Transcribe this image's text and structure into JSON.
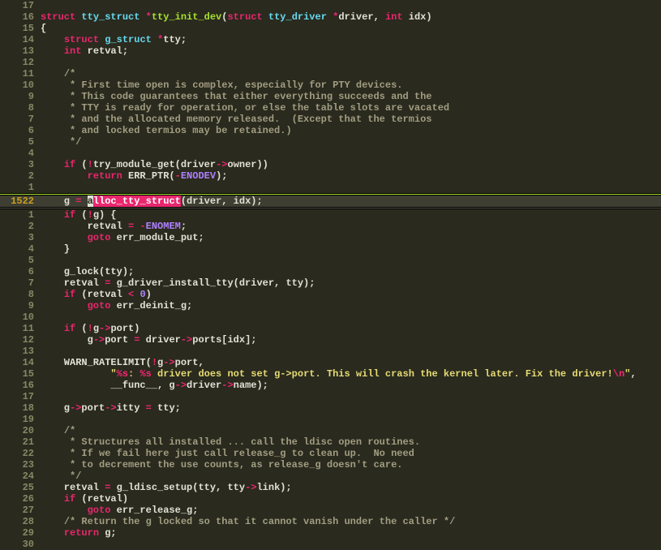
{
  "editor": {
    "cursor_line_abs": 1522,
    "lines": [
      {
        "n": "17",
        "cls": "",
        "spans": [
          [
            "id",
            ""
          ]
        ]
      },
      {
        "n": "16",
        "cls": "",
        "spans": [
          [
            "kw",
            "struct"
          ],
          [
            "id",
            " "
          ],
          [
            "type",
            "tty_struct"
          ],
          [
            "id",
            " "
          ],
          [
            "op",
            "*"
          ],
          [
            "fn",
            "tty_init_dev"
          ],
          [
            "pun",
            "("
          ],
          [
            "kw",
            "struct"
          ],
          [
            "id",
            " "
          ],
          [
            "type",
            "tty_driver"
          ],
          [
            "id",
            " "
          ],
          [
            "op",
            "*"
          ],
          [
            "id",
            "driver"
          ],
          [
            "pun",
            ", "
          ],
          [
            "kw",
            "int"
          ],
          [
            "id",
            " idx"
          ],
          [
            "pun",
            ")"
          ]
        ]
      },
      {
        "n": "15",
        "cls": "",
        "spans": [
          [
            "pun",
            "{"
          ]
        ]
      },
      {
        "n": "14",
        "cls": "",
        "spans": [
          [
            "id",
            "    "
          ],
          [
            "kw",
            "struct"
          ],
          [
            "id",
            " "
          ],
          [
            "type",
            "g_struct"
          ],
          [
            "id",
            " "
          ],
          [
            "op",
            "*"
          ],
          [
            "id",
            "tty;"
          ]
        ]
      },
      {
        "n": "13",
        "cls": "",
        "spans": [
          [
            "id",
            "    "
          ],
          [
            "kw",
            "int"
          ],
          [
            "id",
            " retval;"
          ]
        ]
      },
      {
        "n": "12",
        "cls": "",
        "spans": [
          [
            "id",
            ""
          ]
        ]
      },
      {
        "n": "11",
        "cls": "",
        "spans": [
          [
            "id",
            "    "
          ],
          [
            "cmt",
            "/*"
          ]
        ]
      },
      {
        "n": "10",
        "cls": "",
        "spans": [
          [
            "id",
            "    "
          ],
          [
            "cmt",
            " * First time open is complex, especially for PTY devices."
          ]
        ]
      },
      {
        "n": "9",
        "cls": "",
        "spans": [
          [
            "id",
            "    "
          ],
          [
            "cmt",
            " * This code guarantees that either everything succeeds and the"
          ]
        ]
      },
      {
        "n": "8",
        "cls": "",
        "spans": [
          [
            "id",
            "    "
          ],
          [
            "cmt",
            " * TTY is ready for operation, or else the table slots are vacated"
          ]
        ]
      },
      {
        "n": "7",
        "cls": "",
        "spans": [
          [
            "id",
            "    "
          ],
          [
            "cmt",
            " * and the allocated memory released.  (Except that the termios"
          ]
        ]
      },
      {
        "n": "6",
        "cls": "",
        "spans": [
          [
            "id",
            "    "
          ],
          [
            "cmt",
            " * and locked termios may be retained.)"
          ]
        ]
      },
      {
        "n": "5",
        "cls": "",
        "spans": [
          [
            "id",
            "    "
          ],
          [
            "cmt",
            " */"
          ]
        ]
      },
      {
        "n": "4",
        "cls": "",
        "spans": [
          [
            "id",
            ""
          ]
        ]
      },
      {
        "n": "3",
        "cls": "",
        "spans": [
          [
            "id",
            "    "
          ],
          [
            "kw",
            "if"
          ],
          [
            "id",
            " ("
          ],
          [
            "op",
            "!"
          ],
          [
            "id",
            "try_module_get(driver"
          ],
          [
            "op",
            "->"
          ],
          [
            "id",
            "owner))"
          ]
        ]
      },
      {
        "n": "2",
        "cls": "",
        "spans": [
          [
            "id",
            "        "
          ],
          [
            "kw",
            "return"
          ],
          [
            "id",
            " ERR_PTR("
          ],
          [
            "op",
            "-"
          ],
          [
            "const",
            "ENODEV"
          ],
          [
            "id",
            ");"
          ]
        ]
      },
      {
        "n": "1",
        "cls": "",
        "spans": [
          [
            "id",
            ""
          ]
        ]
      },
      {
        "n": "1522",
        "cls": "current",
        "abs": true,
        "spans": [
          [
            "id",
            "    g "
          ],
          [
            "op",
            "="
          ],
          [
            "id",
            " "
          ],
          [
            "cursor",
            "a"
          ],
          [
            "hl",
            "lloc_tty_struct"
          ],
          [
            "id",
            "(driver, idx);"
          ]
        ]
      },
      {
        "n": "1",
        "cls": "",
        "spans": [
          [
            "id",
            "    "
          ],
          [
            "kw",
            "if"
          ],
          [
            "id",
            " ("
          ],
          [
            "op",
            "!"
          ],
          [
            "id",
            "g) {"
          ]
        ]
      },
      {
        "n": "2",
        "cls": "",
        "spans": [
          [
            "id",
            "        retval "
          ],
          [
            "op",
            "="
          ],
          [
            "id",
            " "
          ],
          [
            "op",
            "-"
          ],
          [
            "const",
            "ENOMEM"
          ],
          [
            "id",
            ";"
          ]
        ]
      },
      {
        "n": "3",
        "cls": "",
        "spans": [
          [
            "id",
            "        "
          ],
          [
            "kw",
            "goto"
          ],
          [
            "id",
            " err_module_put;"
          ]
        ]
      },
      {
        "n": "4",
        "cls": "",
        "spans": [
          [
            "id",
            "    }"
          ]
        ]
      },
      {
        "n": "5",
        "cls": "",
        "spans": [
          [
            "id",
            ""
          ]
        ]
      },
      {
        "n": "6",
        "cls": "",
        "spans": [
          [
            "id",
            "    g_lock(tty);"
          ]
        ]
      },
      {
        "n": "7",
        "cls": "",
        "spans": [
          [
            "id",
            "    retval "
          ],
          [
            "op",
            "="
          ],
          [
            "id",
            " g_driver_install_tty(driver, tty);"
          ]
        ]
      },
      {
        "n": "8",
        "cls": "",
        "spans": [
          [
            "id",
            "    "
          ],
          [
            "kw",
            "if"
          ],
          [
            "id",
            " (retval "
          ],
          [
            "op",
            "<"
          ],
          [
            "id",
            " "
          ],
          [
            "num",
            "0"
          ],
          [
            "id",
            ")"
          ]
        ]
      },
      {
        "n": "9",
        "cls": "",
        "spans": [
          [
            "id",
            "        "
          ],
          [
            "kw",
            "goto"
          ],
          [
            "id",
            " err_deinit_g;"
          ]
        ]
      },
      {
        "n": "10",
        "cls": "",
        "spans": [
          [
            "id",
            ""
          ]
        ]
      },
      {
        "n": "11",
        "cls": "",
        "spans": [
          [
            "id",
            "    "
          ],
          [
            "kw",
            "if"
          ],
          [
            "id",
            " ("
          ],
          [
            "op",
            "!"
          ],
          [
            "id",
            "g"
          ],
          [
            "op",
            "->"
          ],
          [
            "id",
            "port)"
          ]
        ]
      },
      {
        "n": "12",
        "cls": "",
        "spans": [
          [
            "id",
            "        g"
          ],
          [
            "op",
            "->"
          ],
          [
            "id",
            "port "
          ],
          [
            "op",
            "="
          ],
          [
            "id",
            " driver"
          ],
          [
            "op",
            "->"
          ],
          [
            "id",
            "ports[idx];"
          ]
        ]
      },
      {
        "n": "13",
        "cls": "",
        "spans": [
          [
            "id",
            ""
          ]
        ]
      },
      {
        "n": "14",
        "cls": "",
        "spans": [
          [
            "id",
            "    WARN_RATELIMIT("
          ],
          [
            "op",
            "!"
          ],
          [
            "id",
            "g"
          ],
          [
            "op",
            "->"
          ],
          [
            "id",
            "port,"
          ]
        ]
      },
      {
        "n": "15",
        "cls": "",
        "spans": [
          [
            "id",
            "            "
          ],
          [
            "str",
            "\""
          ],
          [
            "esc",
            "%s"
          ],
          [
            "str",
            ": "
          ],
          [
            "esc",
            "%s"
          ],
          [
            "str",
            " driver does not set g->port. This will crash the kernel later. Fix the driver!"
          ],
          [
            "esc",
            "\\n"
          ],
          [
            "str",
            "\""
          ],
          [
            "id",
            ","
          ]
        ]
      },
      {
        "n": "16",
        "cls": "",
        "spans": [
          [
            "id",
            "            __func__, g"
          ],
          [
            "op",
            "->"
          ],
          [
            "id",
            "driver"
          ],
          [
            "op",
            "->"
          ],
          [
            "id",
            "name);"
          ]
        ]
      },
      {
        "n": "17",
        "cls": "",
        "spans": [
          [
            "id",
            ""
          ]
        ]
      },
      {
        "n": "18",
        "cls": "",
        "spans": [
          [
            "id",
            "    g"
          ],
          [
            "op",
            "->"
          ],
          [
            "id",
            "port"
          ],
          [
            "op",
            "->"
          ],
          [
            "id",
            "itty "
          ],
          [
            "op",
            "="
          ],
          [
            "id",
            " tty;"
          ]
        ]
      },
      {
        "n": "19",
        "cls": "",
        "spans": [
          [
            "id",
            ""
          ]
        ]
      },
      {
        "n": "20",
        "cls": "",
        "spans": [
          [
            "id",
            "    "
          ],
          [
            "cmt",
            "/*"
          ]
        ]
      },
      {
        "n": "21",
        "cls": "",
        "spans": [
          [
            "id",
            "    "
          ],
          [
            "cmt",
            " * Structures all installed ... call the ldisc open routines."
          ]
        ]
      },
      {
        "n": "22",
        "cls": "",
        "spans": [
          [
            "id",
            "    "
          ],
          [
            "cmt",
            " * If we fail here just call release_g to clean up.  No need"
          ]
        ]
      },
      {
        "n": "23",
        "cls": "",
        "spans": [
          [
            "id",
            "    "
          ],
          [
            "cmt",
            " * to decrement the use counts, as release_g doesn't care."
          ]
        ]
      },
      {
        "n": "24",
        "cls": "",
        "spans": [
          [
            "id",
            "    "
          ],
          [
            "cmt",
            " */"
          ]
        ]
      },
      {
        "n": "25",
        "cls": "",
        "spans": [
          [
            "id",
            "    retval "
          ],
          [
            "op",
            "="
          ],
          [
            "id",
            " g_ldisc_setup(tty, tty"
          ],
          [
            "op",
            "->"
          ],
          [
            "id",
            "link);"
          ]
        ]
      },
      {
        "n": "26",
        "cls": "",
        "spans": [
          [
            "id",
            "    "
          ],
          [
            "kw",
            "if"
          ],
          [
            "id",
            " (retval)"
          ]
        ]
      },
      {
        "n": "27",
        "cls": "",
        "spans": [
          [
            "id",
            "        "
          ],
          [
            "kw",
            "goto"
          ],
          [
            "id",
            " err_release_g;"
          ]
        ]
      },
      {
        "n": "28",
        "cls": "",
        "spans": [
          [
            "id",
            "    "
          ],
          [
            "cmt",
            "/* Return the g locked so that it cannot vanish under the caller */"
          ]
        ]
      },
      {
        "n": "29",
        "cls": "",
        "spans": [
          [
            "id",
            "    "
          ],
          [
            "kw",
            "return"
          ],
          [
            "id",
            " g;"
          ]
        ]
      },
      {
        "n": "30",
        "cls": "",
        "spans": [
          [
            "id",
            ""
          ]
        ]
      }
    ]
  }
}
